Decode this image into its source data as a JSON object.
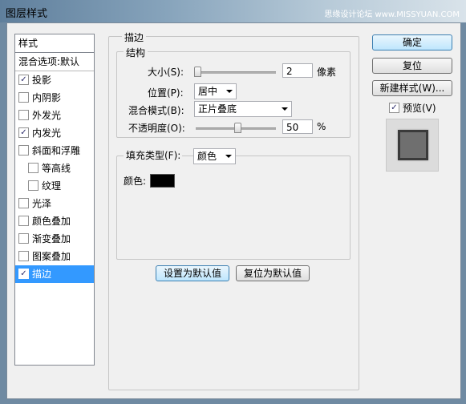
{
  "window": {
    "title": "图层样式",
    "watermark": "思缘设计论坛 www.MISSYUAN.COM"
  },
  "styles": {
    "header": "样式",
    "blend_options": "混合选项:默认",
    "items": [
      {
        "label": "投影",
        "checked": true
      },
      {
        "label": "内阴影",
        "checked": false
      },
      {
        "label": "外发光",
        "checked": false
      },
      {
        "label": "内发光",
        "checked": true
      },
      {
        "label": "斜面和浮雕",
        "checked": false
      },
      {
        "label": "等高线",
        "checked": false
      },
      {
        "label": "纹理",
        "checked": false
      },
      {
        "label": "光泽",
        "checked": false
      },
      {
        "label": "颜色叠加",
        "checked": false
      },
      {
        "label": "渐变叠加",
        "checked": false
      },
      {
        "label": "图案叠加",
        "checked": false
      },
      {
        "label": "描边",
        "checked": true
      }
    ]
  },
  "stroke": {
    "group_title": "描边",
    "structure": {
      "title": "结构",
      "size_label": "大小(S):",
      "size_value": "2",
      "size_unit": "像素",
      "size_slider": 0.0,
      "position_label": "位置(P):",
      "position_value": "居中",
      "blend_mode_label": "混合模式(B):",
      "blend_mode_value": "正片叠底",
      "opacity_label": "不透明度(O):",
      "opacity_value": "50",
      "opacity_unit": "%",
      "opacity_slider": 0.5
    },
    "fill": {
      "fill_type_label": "填充类型(F):",
      "fill_type_value": "颜色",
      "color_label": "颜色:",
      "color": "#000000"
    },
    "set_default": "设置为默认值",
    "reset_default": "复位为默认值"
  },
  "buttons": {
    "ok": "确定",
    "reset": "复位",
    "new_style": "新建样式(W)...",
    "preview_label": "预览(V)",
    "preview_checked": true
  }
}
